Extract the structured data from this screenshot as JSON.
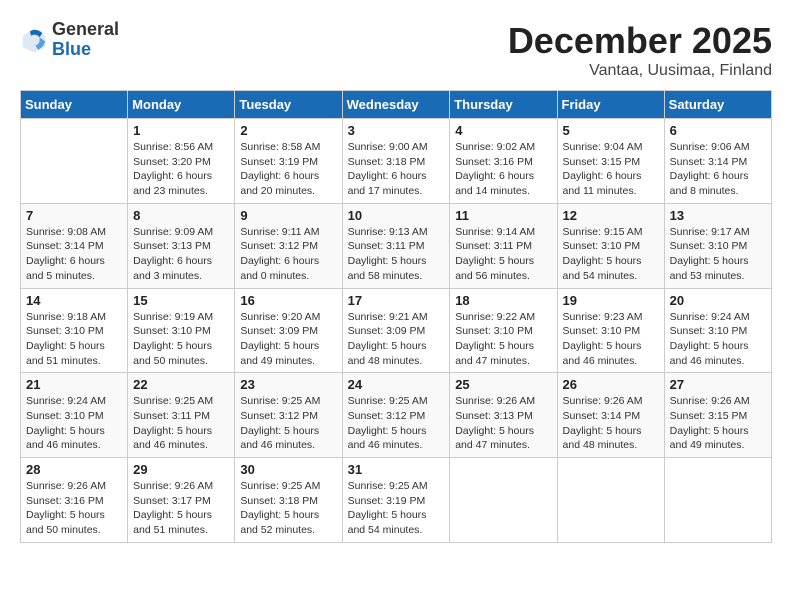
{
  "header": {
    "logo_general": "General",
    "logo_blue": "Blue",
    "month_year": "December 2025",
    "location": "Vantaa, Uusimaa, Finland"
  },
  "days_of_week": [
    "Sunday",
    "Monday",
    "Tuesday",
    "Wednesday",
    "Thursday",
    "Friday",
    "Saturday"
  ],
  "weeks": [
    [
      {
        "day": "",
        "info": ""
      },
      {
        "day": "1",
        "info": "Sunrise: 8:56 AM\nSunset: 3:20 PM\nDaylight: 6 hours\nand 23 minutes."
      },
      {
        "day": "2",
        "info": "Sunrise: 8:58 AM\nSunset: 3:19 PM\nDaylight: 6 hours\nand 20 minutes."
      },
      {
        "day": "3",
        "info": "Sunrise: 9:00 AM\nSunset: 3:18 PM\nDaylight: 6 hours\nand 17 minutes."
      },
      {
        "day": "4",
        "info": "Sunrise: 9:02 AM\nSunset: 3:16 PM\nDaylight: 6 hours\nand 14 minutes."
      },
      {
        "day": "5",
        "info": "Sunrise: 9:04 AM\nSunset: 3:15 PM\nDaylight: 6 hours\nand 11 minutes."
      },
      {
        "day": "6",
        "info": "Sunrise: 9:06 AM\nSunset: 3:14 PM\nDaylight: 6 hours\nand 8 minutes."
      }
    ],
    [
      {
        "day": "7",
        "info": "Sunrise: 9:08 AM\nSunset: 3:14 PM\nDaylight: 6 hours\nand 5 minutes."
      },
      {
        "day": "8",
        "info": "Sunrise: 9:09 AM\nSunset: 3:13 PM\nDaylight: 6 hours\nand 3 minutes."
      },
      {
        "day": "9",
        "info": "Sunrise: 9:11 AM\nSunset: 3:12 PM\nDaylight: 6 hours\nand 0 minutes."
      },
      {
        "day": "10",
        "info": "Sunrise: 9:13 AM\nSunset: 3:11 PM\nDaylight: 5 hours\nand 58 minutes."
      },
      {
        "day": "11",
        "info": "Sunrise: 9:14 AM\nSunset: 3:11 PM\nDaylight: 5 hours\nand 56 minutes."
      },
      {
        "day": "12",
        "info": "Sunrise: 9:15 AM\nSunset: 3:10 PM\nDaylight: 5 hours\nand 54 minutes."
      },
      {
        "day": "13",
        "info": "Sunrise: 9:17 AM\nSunset: 3:10 PM\nDaylight: 5 hours\nand 53 minutes."
      }
    ],
    [
      {
        "day": "14",
        "info": "Sunrise: 9:18 AM\nSunset: 3:10 PM\nDaylight: 5 hours\nand 51 minutes."
      },
      {
        "day": "15",
        "info": "Sunrise: 9:19 AM\nSunset: 3:10 PM\nDaylight: 5 hours\nand 50 minutes."
      },
      {
        "day": "16",
        "info": "Sunrise: 9:20 AM\nSunset: 3:09 PM\nDaylight: 5 hours\nand 49 minutes."
      },
      {
        "day": "17",
        "info": "Sunrise: 9:21 AM\nSunset: 3:09 PM\nDaylight: 5 hours\nand 48 minutes."
      },
      {
        "day": "18",
        "info": "Sunrise: 9:22 AM\nSunset: 3:10 PM\nDaylight: 5 hours\nand 47 minutes."
      },
      {
        "day": "19",
        "info": "Sunrise: 9:23 AM\nSunset: 3:10 PM\nDaylight: 5 hours\nand 46 minutes."
      },
      {
        "day": "20",
        "info": "Sunrise: 9:24 AM\nSunset: 3:10 PM\nDaylight: 5 hours\nand 46 minutes."
      }
    ],
    [
      {
        "day": "21",
        "info": "Sunrise: 9:24 AM\nSunset: 3:10 PM\nDaylight: 5 hours\nand 46 minutes."
      },
      {
        "day": "22",
        "info": "Sunrise: 9:25 AM\nSunset: 3:11 PM\nDaylight: 5 hours\nand 46 minutes."
      },
      {
        "day": "23",
        "info": "Sunrise: 9:25 AM\nSunset: 3:12 PM\nDaylight: 5 hours\nand 46 minutes."
      },
      {
        "day": "24",
        "info": "Sunrise: 9:25 AM\nSunset: 3:12 PM\nDaylight: 5 hours\nand 46 minutes."
      },
      {
        "day": "25",
        "info": "Sunrise: 9:26 AM\nSunset: 3:13 PM\nDaylight: 5 hours\nand 47 minutes."
      },
      {
        "day": "26",
        "info": "Sunrise: 9:26 AM\nSunset: 3:14 PM\nDaylight: 5 hours\nand 48 minutes."
      },
      {
        "day": "27",
        "info": "Sunrise: 9:26 AM\nSunset: 3:15 PM\nDaylight: 5 hours\nand 49 minutes."
      }
    ],
    [
      {
        "day": "28",
        "info": "Sunrise: 9:26 AM\nSunset: 3:16 PM\nDaylight: 5 hours\nand 50 minutes."
      },
      {
        "day": "29",
        "info": "Sunrise: 9:26 AM\nSunset: 3:17 PM\nDaylight: 5 hours\nand 51 minutes."
      },
      {
        "day": "30",
        "info": "Sunrise: 9:25 AM\nSunset: 3:18 PM\nDaylight: 5 hours\nand 52 minutes."
      },
      {
        "day": "31",
        "info": "Sunrise: 9:25 AM\nSunset: 3:19 PM\nDaylight: 5 hours\nand 54 minutes."
      },
      {
        "day": "",
        "info": ""
      },
      {
        "day": "",
        "info": ""
      },
      {
        "day": "",
        "info": ""
      }
    ]
  ]
}
